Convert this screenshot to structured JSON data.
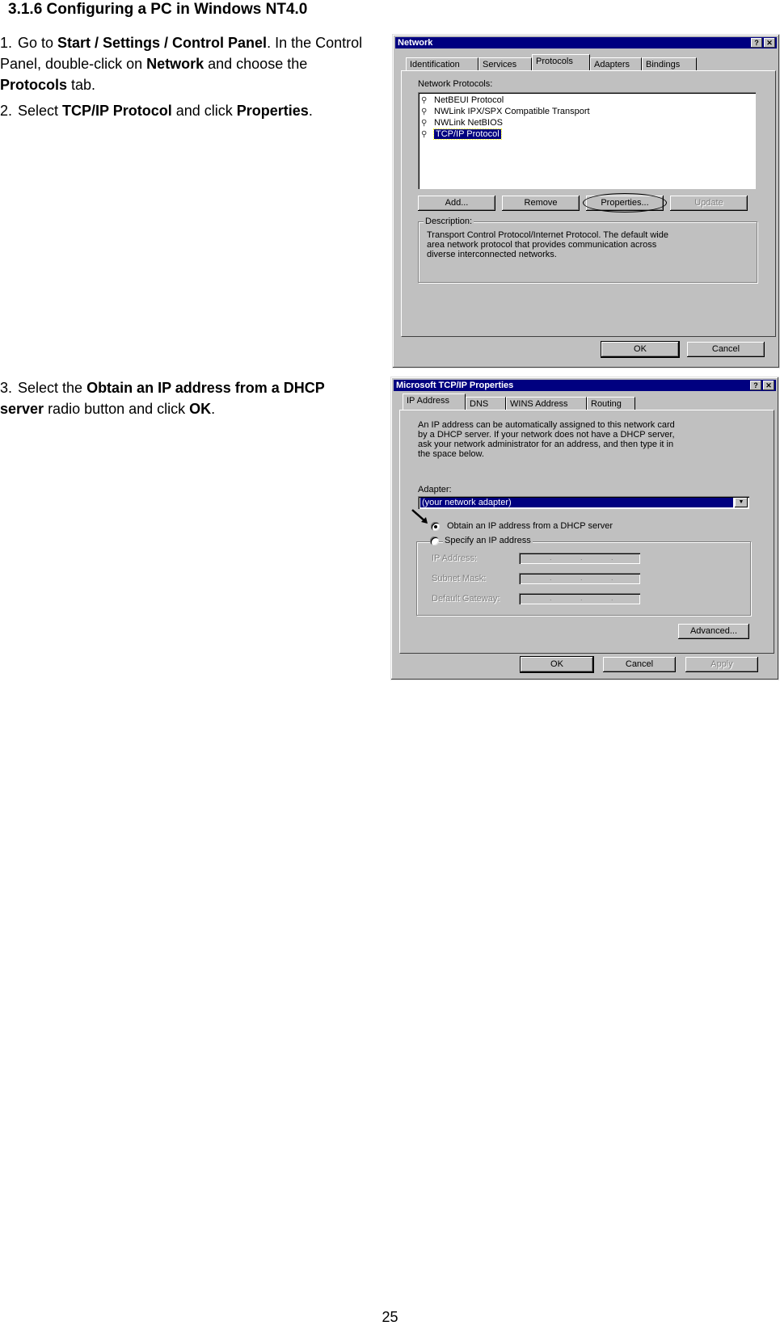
{
  "heading": "3.1.6 Configuring a PC in Windows NT4.0",
  "steps": [
    {
      "num": "1.",
      "parts": [
        "Go to ",
        "Start / Settings / Control Panel",
        ". In the Control Panel, double-click on ",
        "Network",
        " and choose the ",
        "Protocols",
        " tab."
      ]
    },
    {
      "num": "2.",
      "parts": [
        "Select ",
        "TCP/IP Protocol",
        " and click ",
        "Properties",
        "."
      ]
    },
    {
      "num": "3.",
      "parts": [
        "Select the ",
        "Obtain an IP address from a DHCP server",
        " radio button and click ",
        "OK",
        "."
      ]
    }
  ],
  "network_dialog": {
    "title": "Network",
    "help_btn": "?",
    "close_btn": "✕",
    "tabs": [
      "Identification",
      "Services",
      "Protocols",
      "Adapters",
      "Bindings"
    ],
    "active_tab": "Protocols",
    "list_label": "Network Protocols:",
    "protocols": [
      "NetBEUI Protocol",
      "NWLink IPX/SPX Compatible Transport",
      "NWLink NetBIOS",
      "TCP/IP Protocol"
    ],
    "selected_protocol": "TCP/IP Protocol",
    "buttons": {
      "add": "Add...",
      "remove": "Remove",
      "properties": "Properties...",
      "update": "Update"
    },
    "description_label": "Description:",
    "description_lines": [
      "Transport Control Protocol/Internet Protocol. The default wide",
      "area network protocol that provides communication across",
      "diverse interconnected networks."
    ],
    "ok": "OK",
    "cancel": "Cancel"
  },
  "tcpip_dialog": {
    "title": "Microsoft TCP/IP Properties",
    "help_btn": "?",
    "close_btn": "✕",
    "tabs": [
      "IP Address",
      "DNS",
      "WINS Address",
      "Routing"
    ],
    "active_tab": "IP Address",
    "intro_lines": [
      "An IP address can be automatically assigned to this network card",
      "by a DHCP server.  If your network does not have a DHCP server,",
      "ask your network administrator for an address, and then type it in",
      "the space below."
    ],
    "adapter_label": "Adapter:",
    "adapter_value": "(your network adapter)",
    "radio_dhcp": "Obtain an IP address from a DHCP server",
    "radio_specify": "Specify an IP address",
    "dhcp_selected": true,
    "fields": {
      "ip": "IP Address:",
      "subnet": "Subnet Mask:",
      "gateway": "Default Gateway:"
    },
    "advanced": "Advanced...",
    "ok": "OK",
    "cancel": "Cancel",
    "apply": "Apply"
  },
  "page_number": "25"
}
